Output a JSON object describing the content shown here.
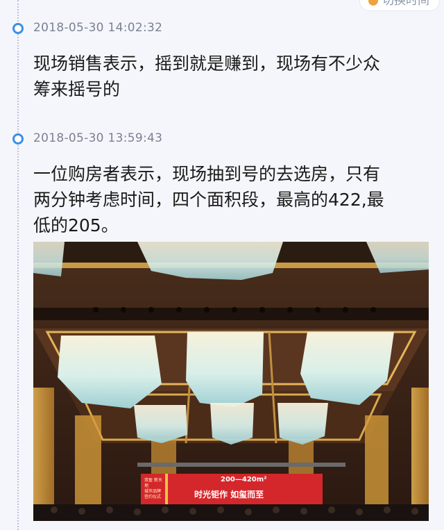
{
  "header": {
    "switch_label": "切换时间"
  },
  "entries": [
    {
      "timestamp": "2018-05-30 14:02:32",
      "text_lines": [
        "现场销售表示，摇到就是赚到，现场有不少众",
        "筹来摇号的"
      ]
    },
    {
      "timestamp": "2018-05-30 13:59:43",
      "text_lines": [
        "一位购房者表示，现场抽到号的去选房，只有",
        "两分钟考虑时间，四个面积段，最高的422,最",
        "低的205。"
      ]
    }
  ],
  "photo": {
    "banner_left_lines": [
      "双盈 新天地",
      "城市品牌",
      "签约仪式"
    ],
    "banner_main": "时光钜作 如玺而至",
    "banner_area": "200—420m²",
    "colors": {
      "banner": "#d4272b",
      "ceiling": "#3a2418",
      "gold": "#d7a649",
      "chandelier": "#cfe9e6"
    }
  }
}
